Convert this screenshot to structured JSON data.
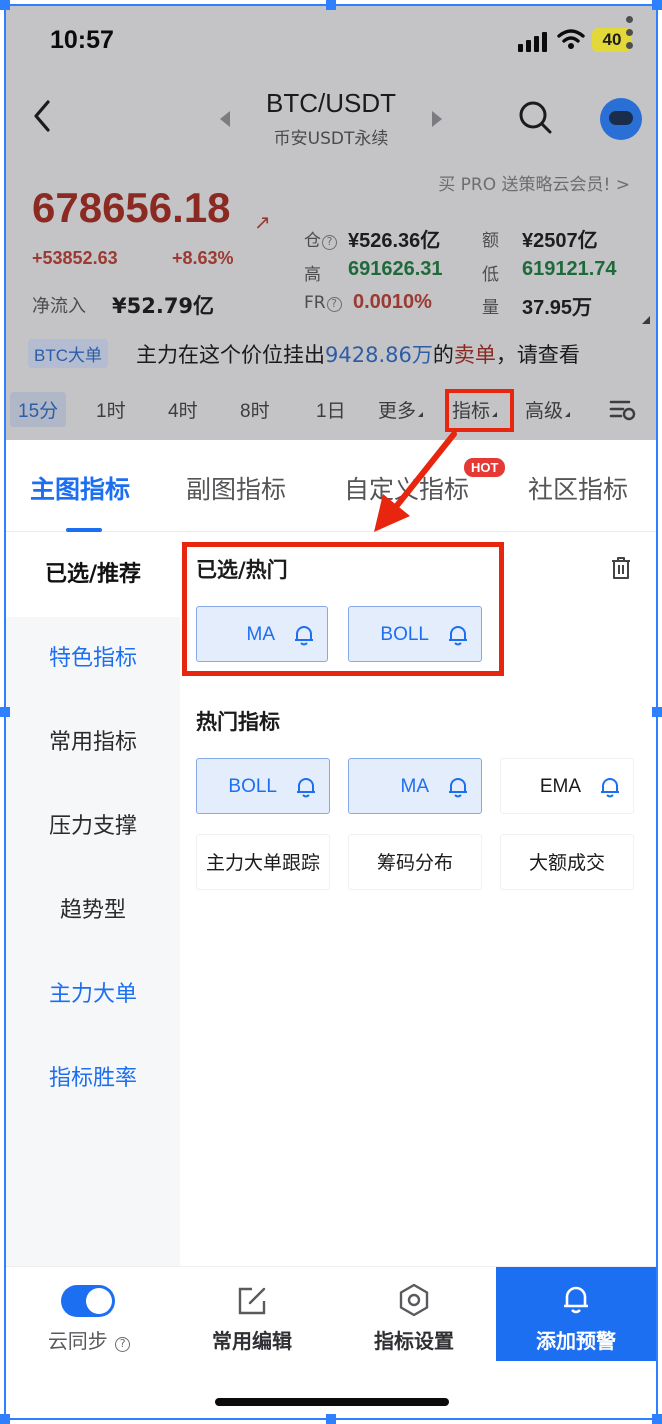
{
  "status_bar": {
    "time": "10:57",
    "battery": "40"
  },
  "header": {
    "pair": "BTC/USDT",
    "market": "币安USDT永续",
    "promo": "买 PRO 送策略云会员!  >"
  },
  "quote": {
    "price": "678656.18",
    "price_arrow": "↗",
    "change_abs": "+53852.63",
    "change_pct": "+8.63%",
    "net_inflow_label": "净流入",
    "net_inflow_value": "¥52.79亿",
    "stats": {
      "position_label": "仓",
      "position_value": "¥526.36亿",
      "amount_label": "额",
      "amount_value": "¥2507亿",
      "high_label": "高",
      "high_value": "691626.31",
      "low_label": "低",
      "low_value": "619121.74",
      "fr_label": "FR",
      "fr_value": "0.0010%",
      "volume_label": "量",
      "volume_value": "37.95万"
    }
  },
  "ticker": {
    "tag": "BTC大单",
    "text_prefix": "主力在这个价位挂出",
    "amount": "9428.86万",
    "text_mid": "的",
    "side": "卖单",
    "text_suffix": "，请查看"
  },
  "timeframes": [
    "15分",
    "1时",
    "4时",
    "8时",
    "1日",
    "更多",
    "指标",
    "高级"
  ],
  "panel": {
    "tabs": [
      "主图指标",
      "副图指标",
      "自定义指标",
      "社区指标"
    ],
    "hot_badge": "HOT",
    "sidebar": [
      "已选/推荐",
      "特色指标",
      "常用指标",
      "压力支撑",
      "趋势型",
      "主力大单",
      "指标胜率"
    ],
    "selected_title": "已选/热门",
    "selected_chips": [
      "MA",
      "BOLL"
    ],
    "hot_title": "热门指标",
    "hot_chips": [
      "BOLL",
      "MA",
      "EMA"
    ],
    "more_chips": [
      "主力大单跟踪",
      "筹码分布",
      "大额成交"
    ]
  },
  "bottom_bar": {
    "sync": "云同步",
    "edit": "常用编辑",
    "settings": "指标设置",
    "alert": "添加预警"
  },
  "colors": {
    "accent": "#1d6ff2",
    "highlight": "#e8260f",
    "up": "#9a3a32",
    "down_green": "#1f6a3a"
  }
}
